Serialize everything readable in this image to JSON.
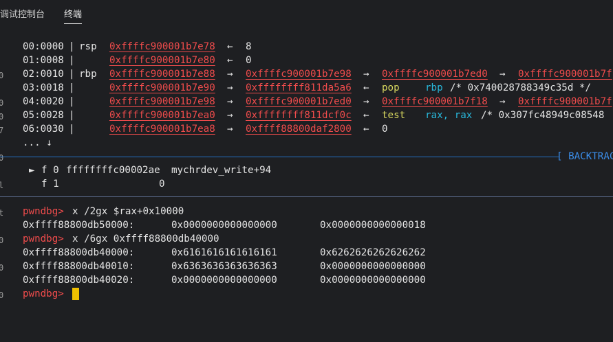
{
  "tabs": {
    "debug_console": "调试控制台",
    "terminal": "终端"
  },
  "gutter": [
    "0",
    "0",
    "0",
    "7",
    "0",
    "l",
    "t",
    "0",
    "0",
    "0"
  ],
  "stack": [
    {
      "idx": "00:0000",
      "reg": "rsp",
      "addr": "0xffffc900001b7e78",
      "arrow": "←",
      "v1": "8"
    },
    {
      "idx": "01:0008",
      "reg": "",
      "addr": "0xffffc900001b7e80",
      "arrow": "←",
      "v1": "0"
    },
    {
      "idx": "02:0010",
      "reg": "rbp",
      "addr": "0xffffc900001b7e88",
      "arrow": "→",
      "v1": "0xffffc900001b7e98",
      "a2": "→",
      "v2": "0xffffc900001b7ed0",
      "a3": "→",
      "v3": "0xffffc900001b7f"
    },
    {
      "idx": "03:0018",
      "reg": "",
      "addr": "0xffffc900001b7e90",
      "arrow": "→",
      "v1": "0xffffffff811da5a6",
      "a2": "←",
      "op": "pop",
      "args": "rbp",
      "comment": "/* 0x740028788349c35d */"
    },
    {
      "idx": "04:0020",
      "reg": "",
      "addr": "0xffffc900001b7e98",
      "arrow": "→",
      "v1": "0xffffc900001b7ed0",
      "a2": "→",
      "v2": "0xffffc900001b7f18",
      "a3": "→",
      "v3": "0xffffc900001b7f"
    },
    {
      "idx": "05:0028",
      "reg": "",
      "addr": "0xffffc900001b7ea0",
      "arrow": "→",
      "v1": "0xffffffff811dcf0c",
      "a2": "←",
      "op": "test",
      "args": "rax, rax",
      "comment": "/* 0x307fc48949c08548"
    },
    {
      "idx": "06:0030",
      "reg": "",
      "addr": "0xffffc900001b7ea8",
      "arrow": "→",
      "v1": "0xffff88800daf2800",
      "a2": "←",
      "v2plain": "0"
    }
  ],
  "ellipsis": "... ↓",
  "backtrace_label": "[ BACKTRAC",
  "backtrace": [
    {
      "marker": "►",
      "frame": "f 0",
      "addr": "ffffffffc00002ae",
      "sym": "mychrdev_write+94"
    },
    {
      "marker": "",
      "frame": "f 1",
      "addr": "0",
      "sym": ""
    }
  ],
  "prompt": "pwndbg>",
  "commands": [
    {
      "cmd": "x /2gx $rax+0x10000",
      "rows": [
        {
          "addr": "0xffff88800db50000:",
          "a": "0x0000000000000000",
          "b": "0x0000000000000018"
        }
      ]
    },
    {
      "cmd": "x /6gx 0xffff88800db40000",
      "rows": [
        {
          "addr": "0xffff88800db40000:",
          "a": "0x6161616161616161",
          "b": "0x6262626262626262"
        },
        {
          "addr": "0xffff88800db40010:",
          "a": "0x6363636363636363",
          "b": "0x0000000000000000"
        },
        {
          "addr": "0xffff88800db40020:",
          "a": "0x0000000000000000",
          "b": "0x0000000000000000"
        }
      ]
    }
  ],
  "colors": {
    "accent_red": "#f14c4c",
    "accent_blue": "#3b8eea",
    "cursor": "#f0c000",
    "background": "#1e1f22"
  }
}
